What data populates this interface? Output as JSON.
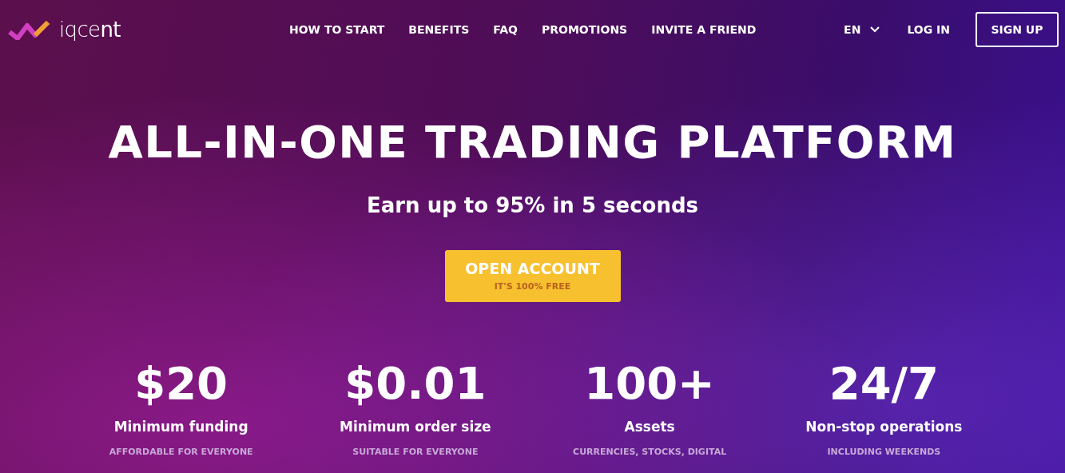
{
  "logo": {
    "text": "iqce**nt**"
  },
  "nav": [
    {
      "label": "HOW TO START"
    },
    {
      "label": "BENEFITS"
    },
    {
      "label": "FAQ"
    },
    {
      "label": "PROMOTIONS"
    },
    {
      "label": "INVITE A FRIEND"
    }
  ],
  "language": {
    "value": "EN"
  },
  "login": "LOG IN",
  "signup": "SIGN UP",
  "hero": {
    "title": "ALL-IN-ONE TRADING PLATFORM",
    "subtitle": "Earn up to 95% in 5 seconds",
    "cta": {
      "label": "OPEN ACCOUNT",
      "note": "IT'S 100% FREE"
    }
  },
  "stats": [
    {
      "value": "$20",
      "label": "Minimum funding",
      "note": "AFFORDABLE FOR EVERYONE"
    },
    {
      "value": "$0.01",
      "label": "Minimum order size",
      "note": "SUITABLE FOR EVERYONE"
    },
    {
      "value": "100+",
      "label": "Assets",
      "note": "CURRENCIES, STOCKS, DIGITAL"
    },
    {
      "value": "24/7",
      "label": "Non-stop operations",
      "note": "INCLUDING WEEKENDS"
    }
  ]
}
